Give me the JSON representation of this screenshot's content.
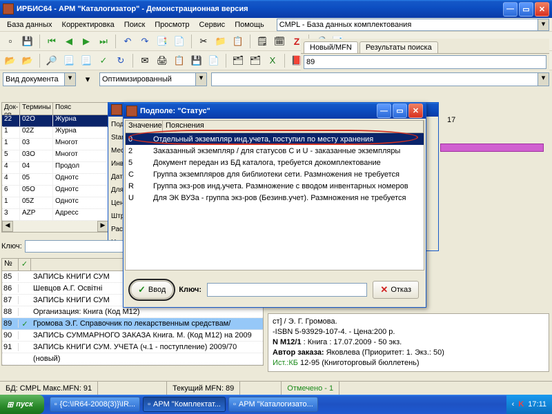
{
  "titlebar": {
    "title": "ИРБИС64 - АРМ \"Каталогизатор\" - Демонстрационная версия"
  },
  "menu": {
    "db": "База данных",
    "edit": "Корректировка",
    "search": "Поиск",
    "view": "Просмотр",
    "service": "Сервис",
    "help": "Помощь"
  },
  "db_combo": {
    "value": "CMPL - База данных комплектования"
  },
  "tabs": {
    "new": "Новый/MFN",
    "results": "Результаты поиска"
  },
  "mfn_input": "89",
  "combo1": {
    "label": "Вид документа"
  },
  "combo2": {
    "value": "Оптимизированный"
  },
  "left_table": {
    "headers": [
      "Док-ов",
      "Термины",
      "Пояс"
    ],
    "rows": [
      {
        "c1": "22",
        "c2": "02O",
        "c3": "Журна",
        "sel": true
      },
      {
        "c1": "1",
        "c2": "02Z",
        "c3": "Журна"
      },
      {
        "c1": "1",
        "c2": "03",
        "c3": "Многот"
      },
      {
        "c1": "5",
        "c2": "03O",
        "c3": "Многот"
      },
      {
        "c1": "4",
        "c2": "04",
        "c3": "Продол"
      },
      {
        "c1": "4",
        "c2": "05",
        "c3": "Однотс"
      },
      {
        "c1": "6",
        "c2": "05O",
        "c3": "Однотс"
      },
      {
        "c1": "1",
        "c2": "05Z",
        "c3": "Однотс"
      },
      {
        "c1": "3",
        "c2": "AZP",
        "c3": "Адресс"
      }
    ]
  },
  "key_label": "Ключ:",
  "midform": {
    "labels": [
      "Подп",
      "Stan",
      "Мест",
      "Инве",
      "Дата",
      "Для L",
      "Цена",
      "Штри",
      "Раст",
      "Наим"
    ]
  },
  "right_17": "17",
  "popup": {
    "title": "Подполе: \"Статус\"",
    "headers": [
      "Значение",
      "Пояснения"
    ],
    "rows": [
      {
        "v": "0",
        "e": "Отдельный экземпляр инд.учета, поступил по месту хранения",
        "sel": true
      },
      {
        "v": "2",
        "e": "Заказанный экземпляр / для статусов C и U - заказанные экземпляры"
      },
      {
        "v": "5",
        "e": "Документ передан из БД каталога, требуется докомплектование"
      },
      {
        "v": "C",
        "e": "Группа экземпляров для библиотеки сети. Размножения не требуется"
      },
      {
        "v": "R",
        "e": "Группа экз-ров инд.учета. Размножение с вводом инвентарных номеров"
      },
      {
        "v": "U",
        "e": "Для ЭК ВУЗа - группа экз-ров (Безинв.учет). Размножения не требуется"
      }
    ],
    "enter": "Ввод",
    "key": "Ключ:",
    "cancel": "Отказ"
  },
  "bot_list": {
    "header_n": "№",
    "rows": [
      {
        "n": "85",
        "chk": false,
        "txt": "ЗАПИСЬ КНИГИ СУМ"
      },
      {
        "n": "86",
        "chk": false,
        "txt": "Шевцов А.Г. Освітні"
      },
      {
        "n": "87",
        "chk": false,
        "txt": "ЗАПИСЬ КНИГИ СУМ"
      },
      {
        "n": "88",
        "chk": false,
        "txt": "   Организация: Книга (Код М12)"
      },
      {
        "n": "89",
        "chk": true,
        "txt": "Громова Э.Г. Справочник по лекарственным средствам/",
        "sel": true
      },
      {
        "n": "90",
        "chk": false,
        "txt": "ЗАПИСЬ СУММАРНОГО ЗАКАЗА   Книга. М. (Код М12) на 2009"
      },
      {
        "n": "91",
        "chk": false,
        "txt": "ЗАПИСЬ КНИГИ СУМ. УЧЕТА (ч.1 - поступление)   2009/70"
      },
      {
        "n": "",
        "chk": false,
        "txt": "(новый)"
      }
    ]
  },
  "details": {
    "line1_suffix": "ст] / Э. Г. Громова.",
    "line2": "-ISBN 5-93929-107-4. - Цена:200 р.",
    "line3_b": "N М12/1",
    "line3": " : Книга : 17.07.2009 - 50 экз.",
    "line4_b": "Автор заказа:",
    "line4": " Яковлева (Приоритет: 1.  Экз.: 50)",
    "line5_a": "Ист.:",
    "line5_b": "КБ",
    "line5": " 12-95 (Книготорговый бюллетень)"
  },
  "status": {
    "db": "БД: CMPL Макс.MFN: 91",
    "mfn": "Текущий MFN: 89",
    "marked": "Отмечено - 1"
  },
  "taskbar": {
    "start": "пуск",
    "items": [
      {
        "label": "{C:\\IR64-2008(3)}\\IR..."
      },
      {
        "label": "АРМ \"Комплектат...",
        "active": true
      },
      {
        "label": "АРМ \"Каталогизато..."
      }
    ],
    "time": "17:11"
  }
}
